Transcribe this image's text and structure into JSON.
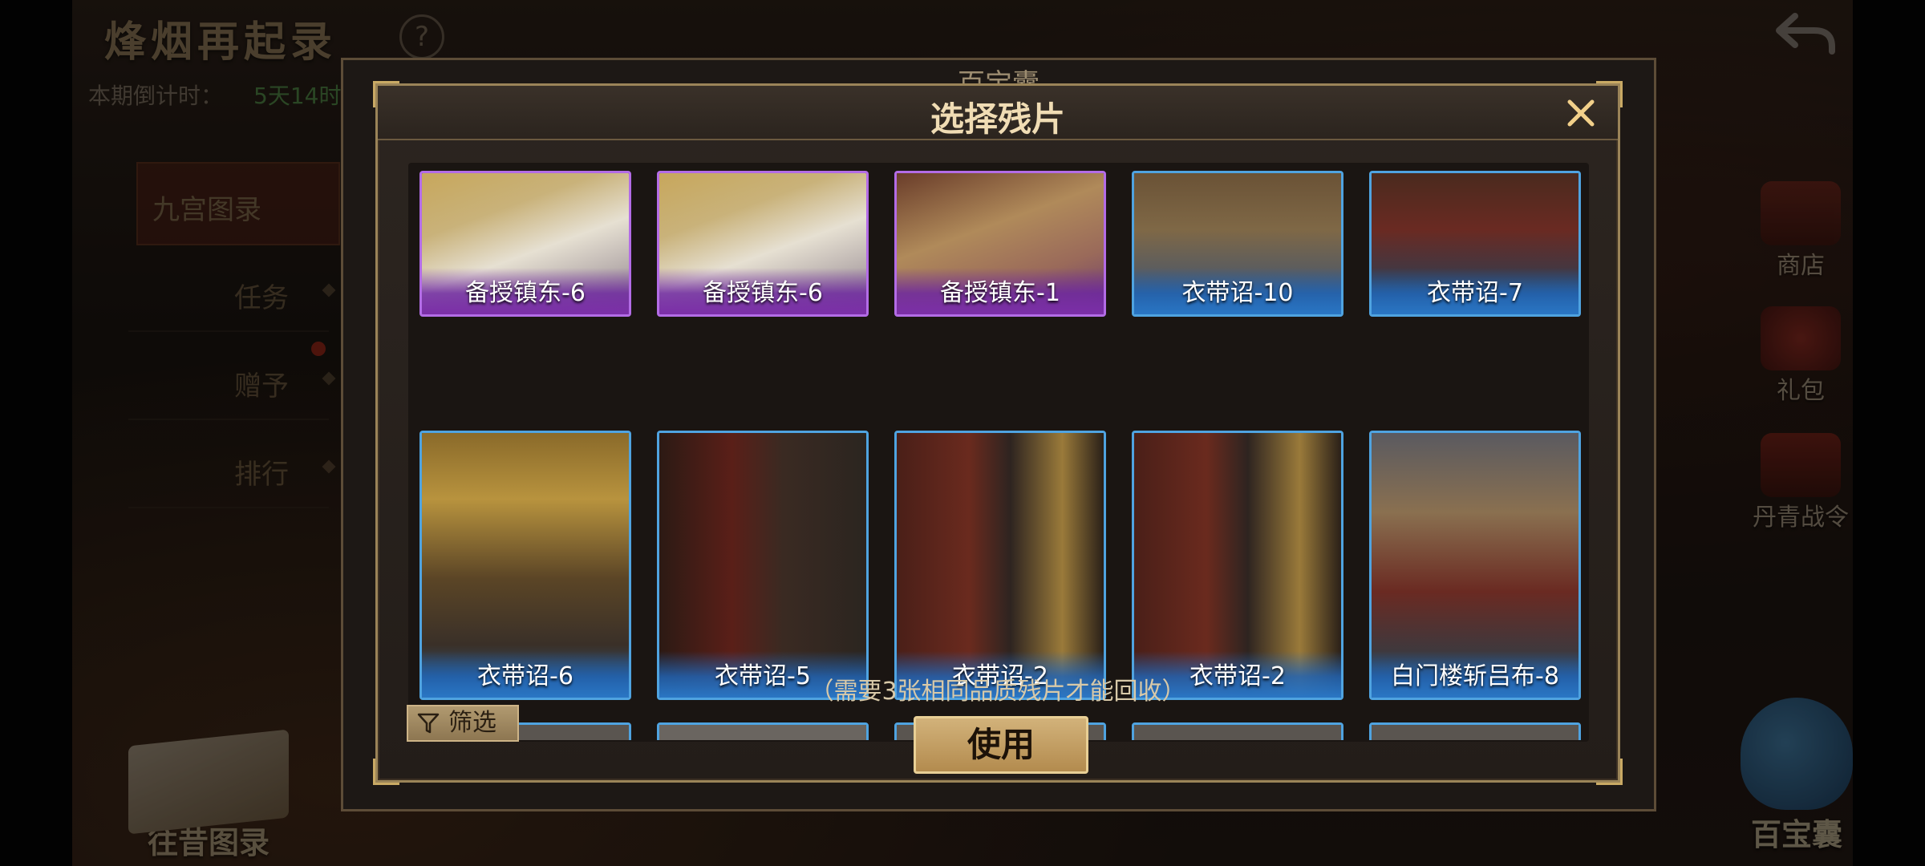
{
  "header": {
    "game_title": "烽烟再起录",
    "help_label": "?",
    "countdown_label": "本期倒计时：",
    "countdown_value": "5天14时"
  },
  "side_tabs": [
    {
      "label": "九宫图录"
    },
    {
      "label": "任务"
    },
    {
      "label": "赠予"
    },
    {
      "label": "排行"
    }
  ],
  "right_menu": [
    {
      "label": "商店",
      "icon": "shop-chest-icon"
    },
    {
      "label": "礼包",
      "icon": "gift-bag-icon"
    },
    {
      "label": "丹青战令",
      "icon": "battle-pass-icon"
    }
  ],
  "bottom_left": {
    "label": "往昔图录"
  },
  "bottom_right": {
    "label": "百宝囊"
  },
  "back_panel": {
    "title": "百宝囊"
  },
  "modal": {
    "title": "选择残片",
    "close_icon": "close-icon",
    "cards": [
      {
        "name": "备授镇东-6",
        "quality": "purple"
      },
      {
        "name": "备授镇东-6",
        "quality": "purple"
      },
      {
        "name": "备授镇东-1",
        "quality": "purple"
      },
      {
        "name": "衣带诏-10",
        "quality": "blue"
      },
      {
        "name": "衣带诏-7",
        "quality": "blue"
      },
      {
        "name": "衣带诏-6",
        "quality": "blue"
      },
      {
        "name": "衣带诏-5",
        "quality": "blue"
      },
      {
        "name": "衣带诏-2",
        "quality": "blue"
      },
      {
        "name": "衣带诏-2",
        "quality": "blue"
      },
      {
        "name": "白门楼斩吕布-8",
        "quality": "blue"
      }
    ],
    "note": "（需要3张相同品质残片才能回收）",
    "filter_label": "筛选",
    "use_label": "使用"
  },
  "colors": {
    "blue_quality": "#2a76c4",
    "purple_quality": "#7c2fa8",
    "gold_accent": "#c9a964",
    "countdown": "#6fd36a"
  }
}
